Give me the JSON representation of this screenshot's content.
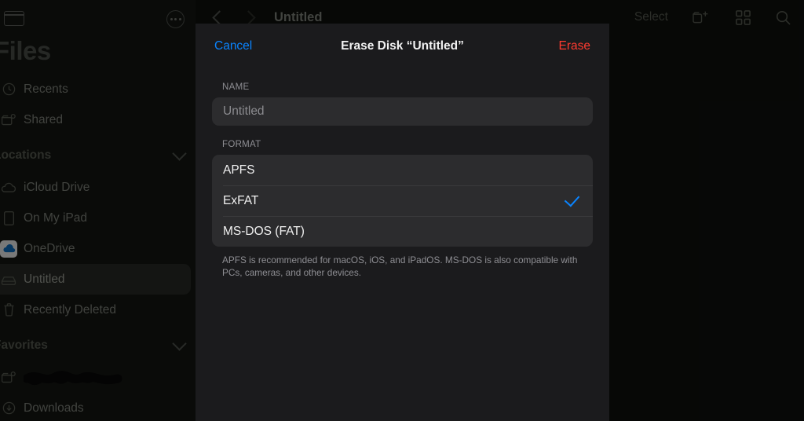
{
  "sidebar": {
    "toggle_icon": "sidebar-toggle-icon",
    "more_icon": "ellipsis-circle-icon",
    "title": "Files",
    "top_items": [
      {
        "label": "Recents",
        "icon": "clock-icon"
      },
      {
        "label": "Shared",
        "icon": "shared-folder-icon"
      }
    ],
    "locations_section": {
      "label": "Locations",
      "chevron": "chevron-down-icon"
    },
    "locations": [
      {
        "label": "iCloud Drive",
        "icon": "cloud-icon",
        "selected": false
      },
      {
        "label": "On My iPad",
        "icon": "ipad-icon",
        "selected": false
      },
      {
        "label": "OneDrive",
        "icon": "onedrive-icon",
        "selected": false
      },
      {
        "label": "Untitled",
        "icon": "external-drive-icon",
        "selected": true
      },
      {
        "label": "Recently Deleted",
        "icon": "trash-icon",
        "selected": false
      }
    ],
    "favorites_section": {
      "label": "Favorites",
      "chevron": "chevron-down-icon"
    },
    "favorites": [
      {
        "label": "",
        "icon": "shared-folder-icon",
        "redacted": true
      },
      {
        "label": "Downloads",
        "icon": "download-circle-icon",
        "redacted": false
      }
    ]
  },
  "main": {
    "back_icon": "chevron-left-icon",
    "forward_icon": "chevron-right-icon",
    "title": "Untitled",
    "select_label": "Select",
    "new_folder_icon": "new-folder-icon",
    "grid_view_icon": "grid-view-icon",
    "search_icon": "search-icon"
  },
  "modal": {
    "cancel_label": "Cancel",
    "title": "Erase Disk “Untitled”",
    "erase_label": "Erase",
    "name_section_label": "NAME",
    "name_value": "",
    "name_placeholder": "Untitled",
    "format_section_label": "FORMAT",
    "format_options": [
      {
        "label": "APFS",
        "selected": false
      },
      {
        "label": "ExFAT",
        "selected": true
      },
      {
        "label": "MS-DOS (FAT)",
        "selected": false
      }
    ],
    "format_footer": "APFS is recommended for macOS, iOS, and iPadOS. MS-DOS is also compatible with PCs, cameras, and other devices.",
    "check_icon": "checkmark-icon"
  },
  "colors": {
    "accent_blue": "#0A84FF",
    "destructive_red": "#FF3B30",
    "sheet_bg": "#1B1B1D",
    "row_bg": "#2C2C2E"
  }
}
